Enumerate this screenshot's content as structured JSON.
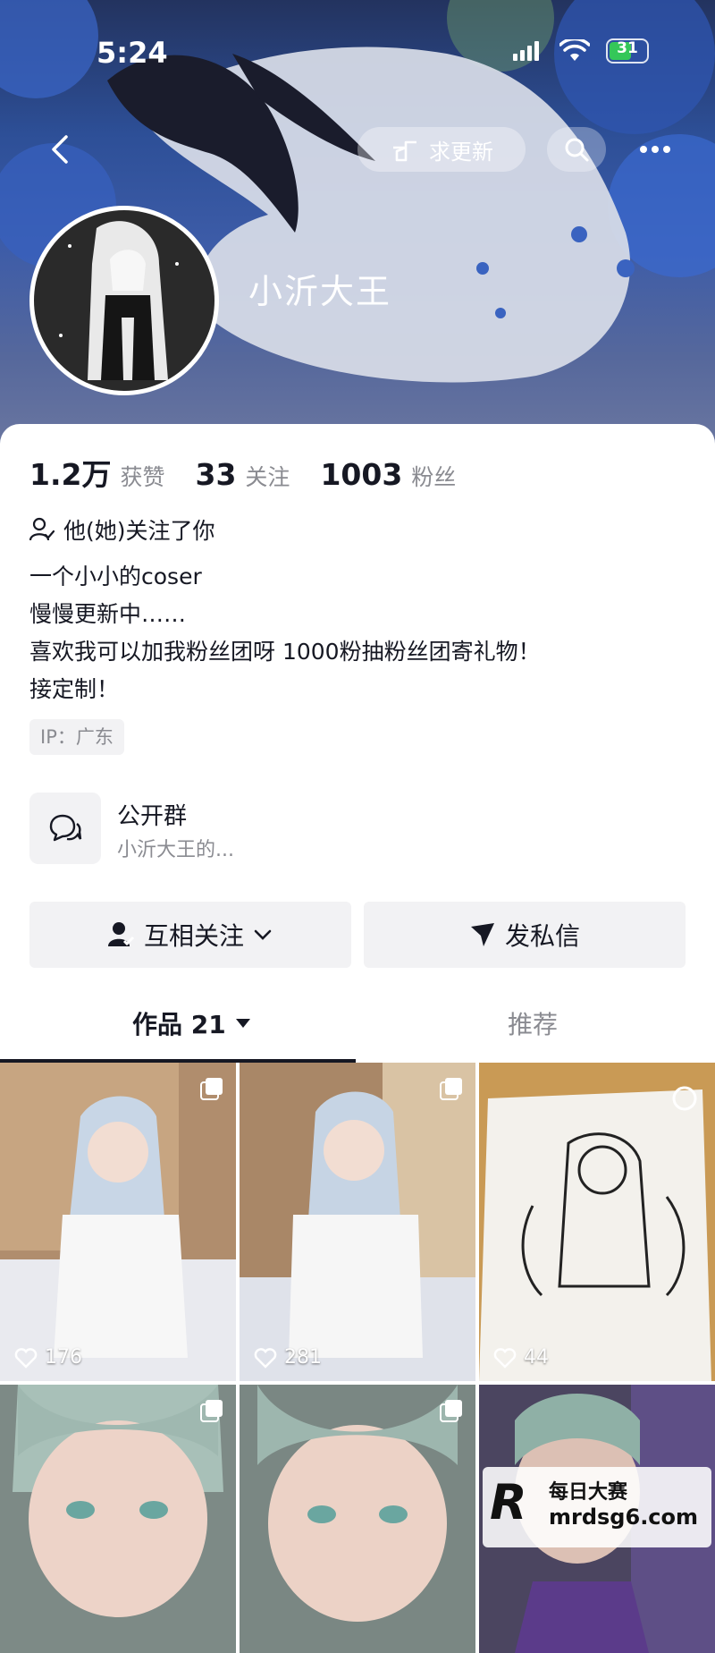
{
  "status": {
    "time": "5:24",
    "battery": "31"
  },
  "header": {
    "request_update_label": "求更新"
  },
  "profile": {
    "name": "小沂大王",
    "stats": [
      {
        "value": "1.2万",
        "label": "获赞"
      },
      {
        "value": "33",
        "label": "关注"
      },
      {
        "value": "1003",
        "label": "粉丝"
      }
    ],
    "follows_you": "他(她)关注了你",
    "bio": [
      "一个小小的coser",
      "慢慢更新中……",
      "喜欢我可以加我粉丝团呀 1000粉抽粉丝团寄礼物！",
      "接定制！"
    ],
    "ip": "IP：广东"
  },
  "group": {
    "title": "公开群",
    "subtitle": "小沂大王的..."
  },
  "actions": {
    "mutual_follow": "互相关注",
    "message": "发私信"
  },
  "tabs": {
    "works": "作品 21",
    "recommend": "推荐"
  },
  "posts": [
    {
      "likes": "176",
      "multi": true
    },
    {
      "likes": "281",
      "multi": true
    },
    {
      "likes": "44",
      "multi": false
    },
    {
      "likes": "",
      "multi": true
    },
    {
      "likes": "",
      "multi": true
    },
    {
      "likes": "",
      "multi": false
    }
  ],
  "watermark": {
    "title": "每日大赛",
    "url": "mrdsg6.com",
    "logo": "R"
  },
  "colors": {
    "accent_text": "#161823",
    "muted_text": "#8a8b91",
    "chip_bg": "#f2f2f4"
  }
}
